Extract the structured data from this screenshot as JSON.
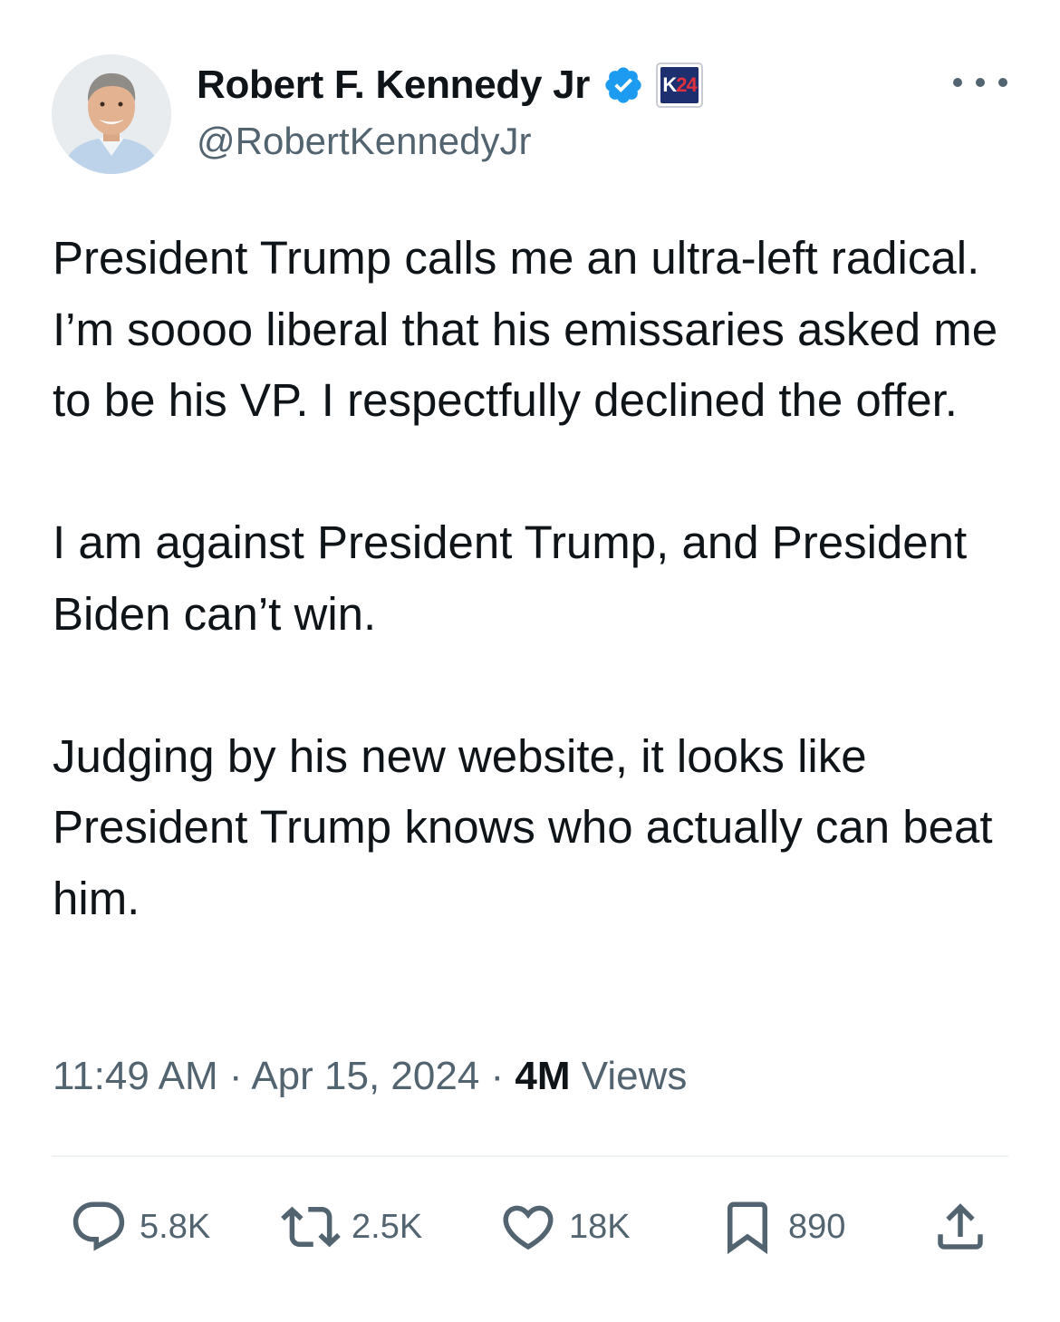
{
  "author": {
    "display_name": "Robert F. Kennedy Jr",
    "handle": "@RobertKennedyJr",
    "badge_text_k": "K",
    "badge_text_num": "24",
    "avatar_icon": "profile-photo",
    "verified_icon": "verified-badge-icon",
    "verified_color": "#1d9bf0"
  },
  "tweet": {
    "paragraphs": [
      "President Trump calls me an ultra-left radical. I’m soooo liberal that his emissaries asked me to be his VP. I respectfully declined the offer.",
      "I am against President Trump, and President Biden can’t win.",
      "Judging by his new website, it looks like President Trump knows who actually can beat him."
    ]
  },
  "meta": {
    "time": "11:49 AM",
    "separator": "·",
    "date": "Apr 15, 2024",
    "views_count": "4M",
    "views_label": "Views"
  },
  "actions": {
    "replies": "5.8K",
    "reposts": "2.5K",
    "likes": "18K",
    "bookmarks": "890"
  },
  "colors": {
    "text_primary": "#0f1419",
    "text_secondary": "#536471",
    "divider": "#eff3f4",
    "accent": "#1d9bf0"
  }
}
